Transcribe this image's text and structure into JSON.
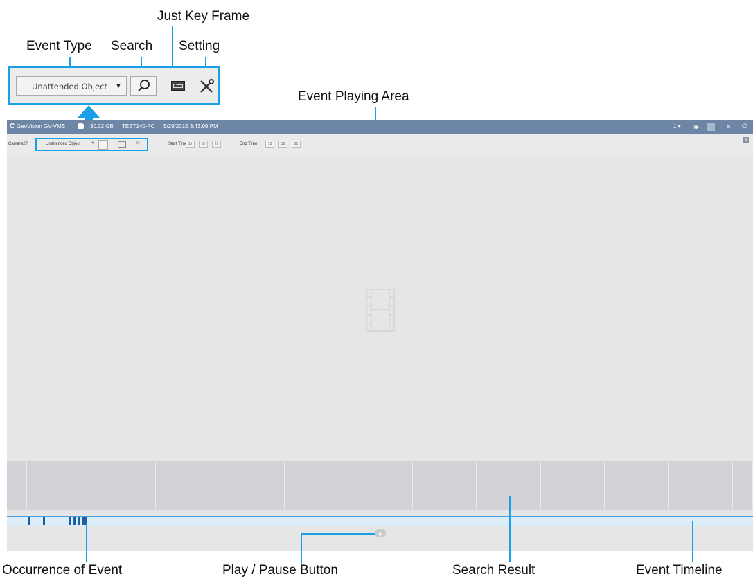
{
  "annotations": {
    "just_key_frame": "Just Key Frame",
    "event_type": "Event Type",
    "search": "Search",
    "setting": "Setting",
    "event_playing_area": "Event Playing Area",
    "occurrence_of_event": "Occurrence of Event",
    "play_pause_button": "Play / Pause Button",
    "search_result": "Search Result",
    "event_timeline": "Event Timeline"
  },
  "zoom": {
    "event_type_value": "Unattended Object"
  },
  "app": {
    "brand": "GeoVision GV-VMS",
    "storage": "30.02 GB",
    "pc_name": "TEST140-PC",
    "datetime": "5/29/2015 3:43:09 PM",
    "screen_select": "1 ▾",
    "camera": "Camera27",
    "event_type_value": "Unattended Object",
    "start_time_label": "Start Time",
    "start_time": [
      "15",
      "32",
      "27"
    ],
    "end_time_label": "End Time",
    "end_time": [
      "15",
      "38",
      "21"
    ]
  },
  "icons": {
    "search": "search-icon",
    "key_frame": "key-frame-icon",
    "setting": "setting-icon",
    "film": "film-icon",
    "play": "play-icon",
    "close": "close-icon"
  },
  "colors": {
    "accent": "#1aa0e6",
    "titlebar": "#6d86a6",
    "timeline_marks": "#1b5fa8"
  }
}
